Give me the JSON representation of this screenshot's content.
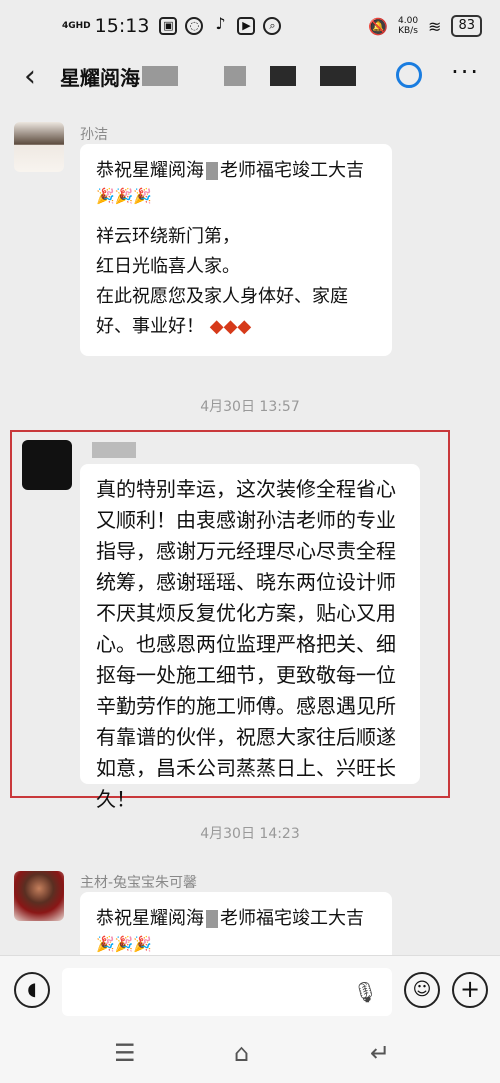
{
  "status": {
    "signal": "4GHD",
    "time": "15:13",
    "speed": "4.00",
    "speed_unit": "KB/s",
    "battery": "83"
  },
  "nav": {
    "back": "‹",
    "title": "星耀阅海",
    "more": "···"
  },
  "messages": [
    {
      "sender": "孙洁",
      "lines": [
        "恭祝星耀阅海",
        "老师福宅竣工大吉",
        "🎉🎉🎉",
        "祥云环绕新门第，",
        "红日光临喜人家。",
        "在此祝愿您及家人身体好、家庭",
        "好、事业好！"
      ],
      "stamps": "◆◆◆"
    },
    {
      "sender": "",
      "text": "真的特别幸运，这次装修全程省心又顺利！由衷感谢孙洁老师的专业指导，感谢万元经理尽心尽责全程统筹，感谢瑶瑶、晓东两位设计师不厌其烦反复优化方案，贴心又用心。也感恩两位监理严格把关、细抠每一处施工细节，更致敬每一位辛勤劳作的施工师傅。感恩遇见所有靠谱的伙伴，祝愿大家往后顺遂如意，昌禾公司蒸蒸日上、兴旺长久！"
    },
    {
      "sender": "主材-兔宝宝朱可馨",
      "line1a": "恭祝星耀阅海",
      "line1b": "老师福宅竣工大吉",
      "confetti": "🎉🎉🎉"
    }
  ],
  "timestamps": [
    "4月30日 13:57",
    "4月30日 14:23"
  ],
  "input": {
    "voice_icon": "voice-icon",
    "emoji_icon": "emoji-icon",
    "plus_icon": "plus-icon"
  }
}
